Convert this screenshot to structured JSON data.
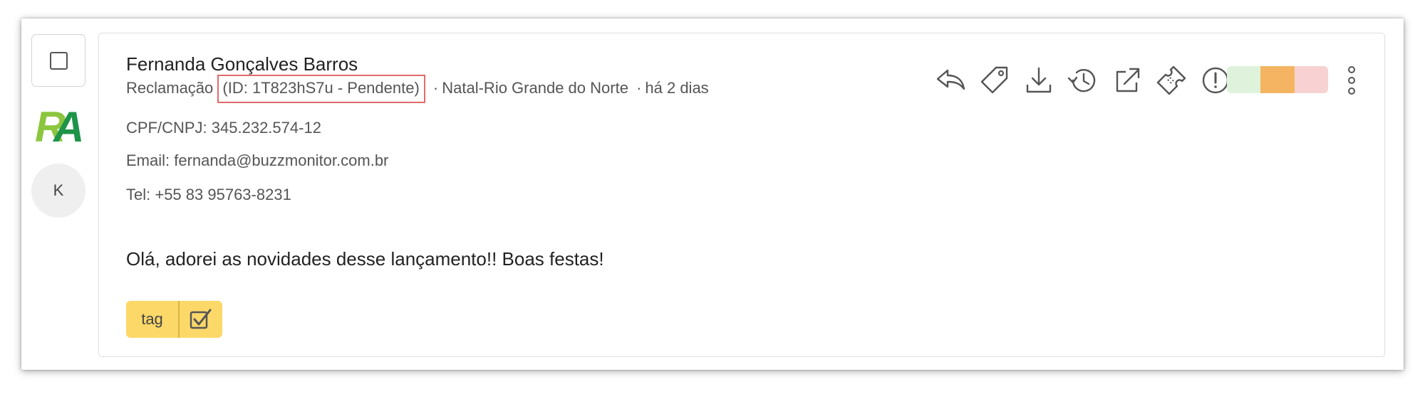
{
  "post": {
    "author": "Fernanda Gonçalves Barros",
    "type": "Reclamação",
    "id_status": "(ID: 1T823hS7u - Pendente)",
    "separator": "·",
    "location": "Natal-Rio Grande do Norte",
    "time": "há 2 dias",
    "cpf": "CPF/CNPJ: 345.232.574-12",
    "email": "Email: fernanda@buzzmonitor.com.br",
    "phone": "Tel: +55 83 95763-8231",
    "message": "Olá, adorei as novidades desse lançamento!! Boas festas!"
  },
  "avatar": {
    "initial": "K"
  },
  "logo": {
    "text": "RA",
    "color_r": "#8cc63f",
    "color_a": "#1e9448"
  },
  "tag": {
    "label": "tag",
    "color": "#fcd869"
  },
  "toolbar": {
    "icons": [
      "reply-icon",
      "tag-icon",
      "download-icon",
      "history-icon",
      "external-link-icon",
      "ticket-icon",
      "alert-icon"
    ]
  },
  "sentiment": {
    "positive_color": "#dff3dc",
    "neutral_color": "#f5b461",
    "negative_color": "#f8d2d2"
  },
  "colors": {
    "highlight_border": "#e06a6a",
    "icon_stroke": "#555555"
  }
}
